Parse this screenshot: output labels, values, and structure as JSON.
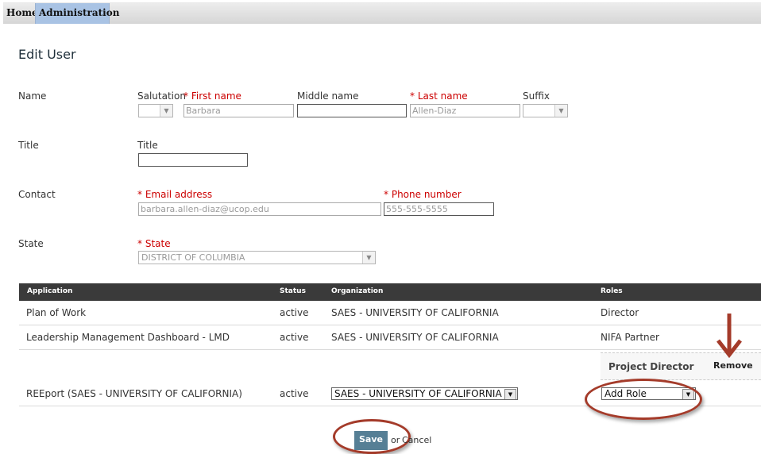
{
  "nav": {
    "home": "Home",
    "administration": "Administration"
  },
  "page": {
    "title": "Edit User"
  },
  "form": {
    "name_section": "Name",
    "salutation_label": "Salutation",
    "first_name_label": "First name",
    "first_name_value": "Barbara",
    "middle_name_label": "Middle name",
    "middle_name_value": "",
    "last_name_label": "Last name",
    "last_name_value": "Allen-Diaz",
    "suffix_label": "Suffix",
    "title_section": "Title",
    "title_label": "Title",
    "title_value": "",
    "contact_section": "Contact",
    "email_label": "Email address",
    "email_value": "barbara.allen-diaz@ucop.edu",
    "phone_label": "Phone number",
    "phone_placeholder": "555-555-5555",
    "state_section": "State",
    "state_label": "State",
    "state_value": "DISTRICT OF COLUMBIA",
    "required_marker": "*"
  },
  "grid": {
    "headers": [
      "Application",
      "Status",
      "Organization",
      "Roles"
    ],
    "rows": [
      {
        "application": "Plan of Work",
        "status": "active",
        "organization": "SAES - UNIVERSITY OF CALIFORNIA",
        "role": "Director"
      },
      {
        "application": "Leadership Management Dashboard - LMD",
        "status": "active",
        "organization": "SAES - UNIVERSITY OF CALIFORNIA",
        "role": "NIFA Partner"
      },
      {
        "application": "REEport (SAES - UNIVERSITY OF CALIFORNIA)",
        "status": "active",
        "organization": "SAES - UNIVERSITY OF CALIFORNIA",
        "role_existing": "Project Director",
        "remove": "Remove",
        "add_role": "Add Role"
      }
    ]
  },
  "actions": {
    "save": "Save",
    "or": "or",
    "cancel": "Cancel"
  },
  "icons": {
    "dropdown": "chevron-down-icon",
    "arrow": "arrow-down-icon"
  },
  "colors": {
    "annotation": "#a43b2a",
    "header_bg": "#3a3a3a",
    "save_bg": "#567f95",
    "nav_active": "#a9c3e4",
    "required": "#cc0000"
  }
}
